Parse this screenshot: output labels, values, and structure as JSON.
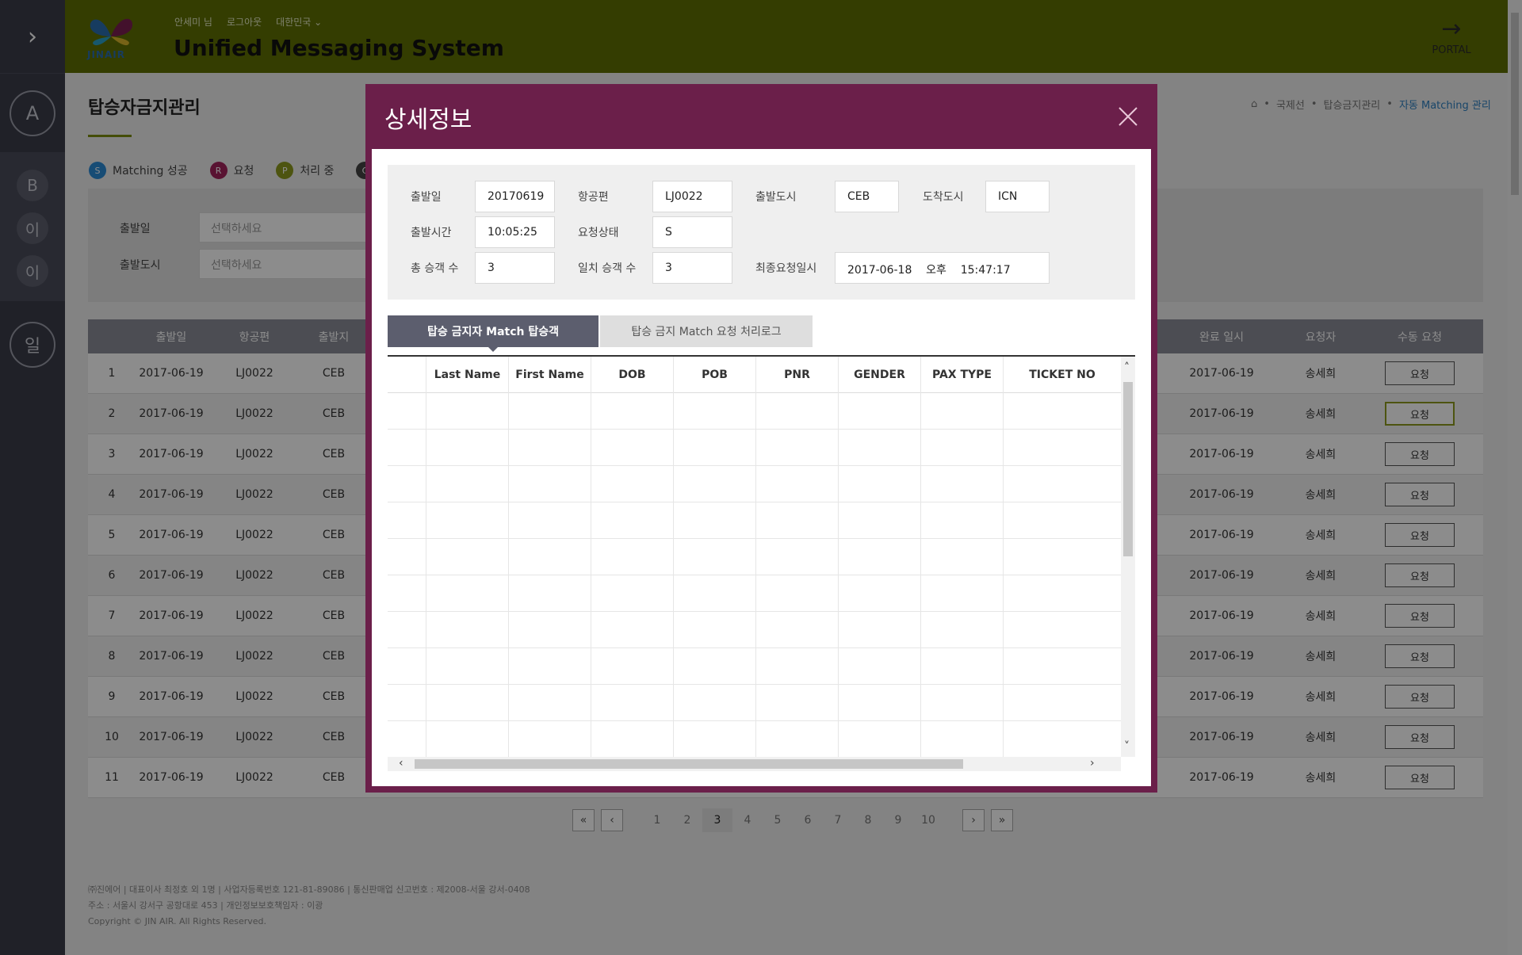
{
  "sidebar": {
    "expand_icon": "chevron-right-icon",
    "items": [
      {
        "label": "A"
      },
      {
        "label": "B"
      },
      {
        "label": "이"
      },
      {
        "label": "이"
      },
      {
        "label": "일"
      }
    ]
  },
  "header": {
    "logo_text": "JINAIR",
    "user_name": "안세미 님",
    "logout": "로그아웃",
    "country": "대한민국",
    "app_title": "Unified Messaging System",
    "portal_label": "PORTAL"
  },
  "page": {
    "title": "탑승자금지관리",
    "breadcrumb": [
      "국제선",
      "탑승금지관리",
      "자동 Matching 관리"
    ],
    "legend": [
      {
        "badge": "S",
        "label": "Matching 성공",
        "color": "#2b8ad6"
      },
      {
        "badge": "R",
        "label": "요청",
        "color": "#a3245c"
      },
      {
        "badge": "P",
        "label": "처리 중",
        "color": "#8c9a1e"
      },
      {
        "badge": "C",
        "label": "",
        "color": "#444444"
      }
    ],
    "filter": {
      "date_label": "출발일",
      "date_placeholder": "선택하세요",
      "city_label": "출발도시",
      "city_placeholder": "선택하세요"
    }
  },
  "table": {
    "headers": [
      "출발일",
      "항공편",
      "출발지",
      "완료 일시",
      "요청자",
      "수동 요청"
    ],
    "rows": [
      {
        "no": "1",
        "date": "2017-06-19",
        "flight": "LJ0022",
        "dep": "CEB",
        "done": "2017-06-19",
        "requester": "송세희",
        "action": "요청"
      },
      {
        "no": "2",
        "date": "2017-06-19",
        "flight": "LJ0022",
        "dep": "CEB",
        "done": "2017-06-19",
        "requester": "송세희",
        "action": "요청"
      },
      {
        "no": "3",
        "date": "2017-06-19",
        "flight": "LJ0022",
        "dep": "CEB",
        "done": "2017-06-19",
        "requester": "송세희",
        "action": "요청"
      },
      {
        "no": "4",
        "date": "2017-06-19",
        "flight": "LJ0022",
        "dep": "CEB",
        "done": "2017-06-19",
        "requester": "송세희",
        "action": "요청"
      },
      {
        "no": "5",
        "date": "2017-06-19",
        "flight": "LJ0022",
        "dep": "CEB",
        "done": "2017-06-19",
        "requester": "송세희",
        "action": "요청"
      },
      {
        "no": "6",
        "date": "2017-06-19",
        "flight": "LJ0022",
        "dep": "CEB",
        "done": "2017-06-19",
        "requester": "송세희",
        "action": "요청"
      },
      {
        "no": "7",
        "date": "2017-06-19",
        "flight": "LJ0022",
        "dep": "CEB",
        "done": "2017-06-19",
        "requester": "송세희",
        "action": "요청"
      },
      {
        "no": "8",
        "date": "2017-06-19",
        "flight": "LJ0022",
        "dep": "CEB",
        "done": "2017-06-19",
        "requester": "송세희",
        "action": "요청"
      },
      {
        "no": "9",
        "date": "2017-06-19",
        "flight": "LJ0022",
        "dep": "CEB",
        "done": "2017-06-19",
        "requester": "송세희",
        "action": "요청"
      },
      {
        "no": "10",
        "date": "2017-06-19",
        "flight": "LJ0022",
        "dep": "CEB",
        "done": "2017-06-19",
        "requester": "송세희",
        "action": "요청"
      },
      {
        "no": "11",
        "date": "2017-06-19",
        "flight": "LJ0022",
        "dep": "CEB",
        "done": "2017-06-19",
        "requester": "송세희",
        "action": "요청"
      }
    ]
  },
  "pagination": {
    "pages": [
      "1",
      "2",
      "3",
      "4",
      "5",
      "6",
      "7",
      "8",
      "9",
      "10"
    ],
    "current": "3"
  },
  "footer": {
    "line1": "㈜진에어 | 대표이사 최정호 외 1명 | 사업자등록번호 121-81-89086 | 통신판매업 신고번호 : 제2008-서울 강서-0408",
    "line2": "주소 : 서울시 강서구 공항대로 453 | 개인정보보호책임자 : 이광",
    "line3": "Copyright © JIN AIR. All Rights Reserved."
  },
  "modal": {
    "title": "상세정보",
    "fields": {
      "dep_date_label": "출발일",
      "dep_date": "20170619",
      "flight_label": "항공편",
      "flight": "LJ0022",
      "dep_city_label": "출발도시",
      "dep_city": "CEB",
      "arr_city_label": "도착도시",
      "arr_city": "ICN",
      "dep_time_label": "출발시간",
      "dep_time": "10:05:25",
      "status_label": "요청상태",
      "status": "S",
      "total_pax_label": "총 승객 수",
      "total_pax": "3",
      "match_pax_label": "일치 승객 수",
      "match_pax": "3",
      "last_req_label": "최종요청일시",
      "last_req": "2017-06-18    오후    15:47:17"
    },
    "tabs": [
      "탑승 금지자 Match 탑승객",
      "탑승 금지 Match 요청 처리로그"
    ],
    "grid_headers": [
      "",
      "Last Name",
      "First Name",
      "DOB",
      "POB",
      "PNR",
      "GENDER",
      "PAX TYPE",
      "TICKET NO"
    ]
  }
}
